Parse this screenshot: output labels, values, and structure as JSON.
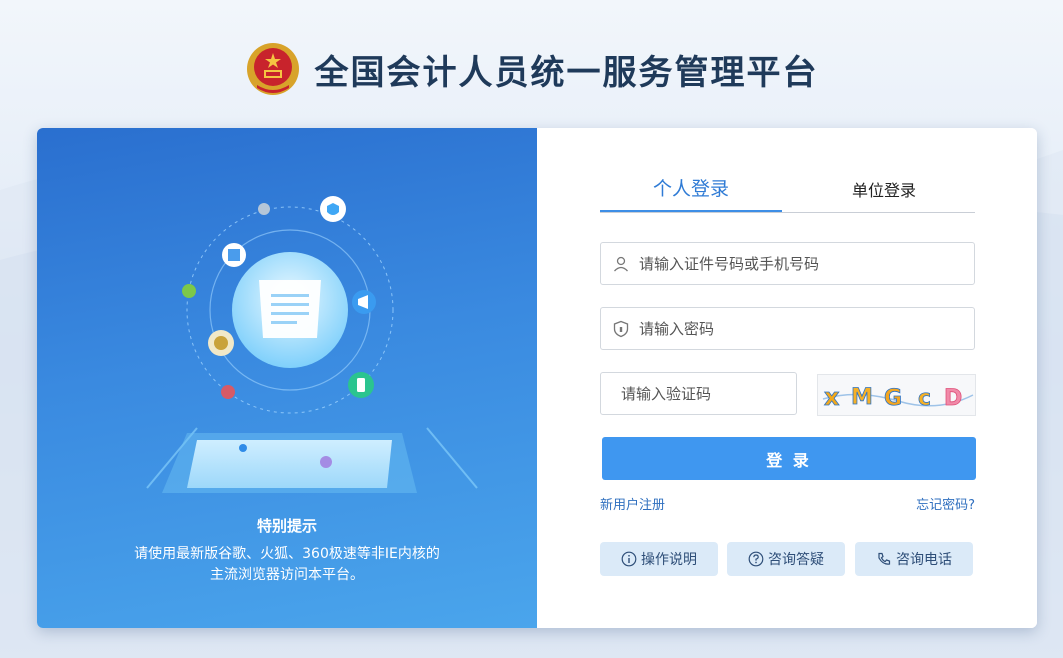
{
  "header": {
    "title": "全国会计人员统一服务管理平台"
  },
  "left": {
    "tip_title": "特别提示",
    "tip_line1": "请使用最新版谷歌、火狐、360极速等非IE内核的",
    "tip_line2": "主流浏览器访问本平台。"
  },
  "login": {
    "tabs": {
      "personal": "个人登录",
      "unit": "单位登录"
    },
    "username_placeholder": "请输入证件号码或手机号码",
    "password_placeholder": "请输入密码",
    "code_placeholder": "请输入验证码",
    "captcha_text": "xMGcD",
    "submit_label": "登 录",
    "register_label": "新用户注册",
    "forgot_label": "忘记密码?"
  },
  "help": {
    "manual": "操作说明",
    "faq": "咨询答疑",
    "phone": "咨询电话"
  },
  "colors": {
    "accent": "#3f97f0",
    "title": "#1f3a5a",
    "panel_blue": "#2a6fcf"
  }
}
